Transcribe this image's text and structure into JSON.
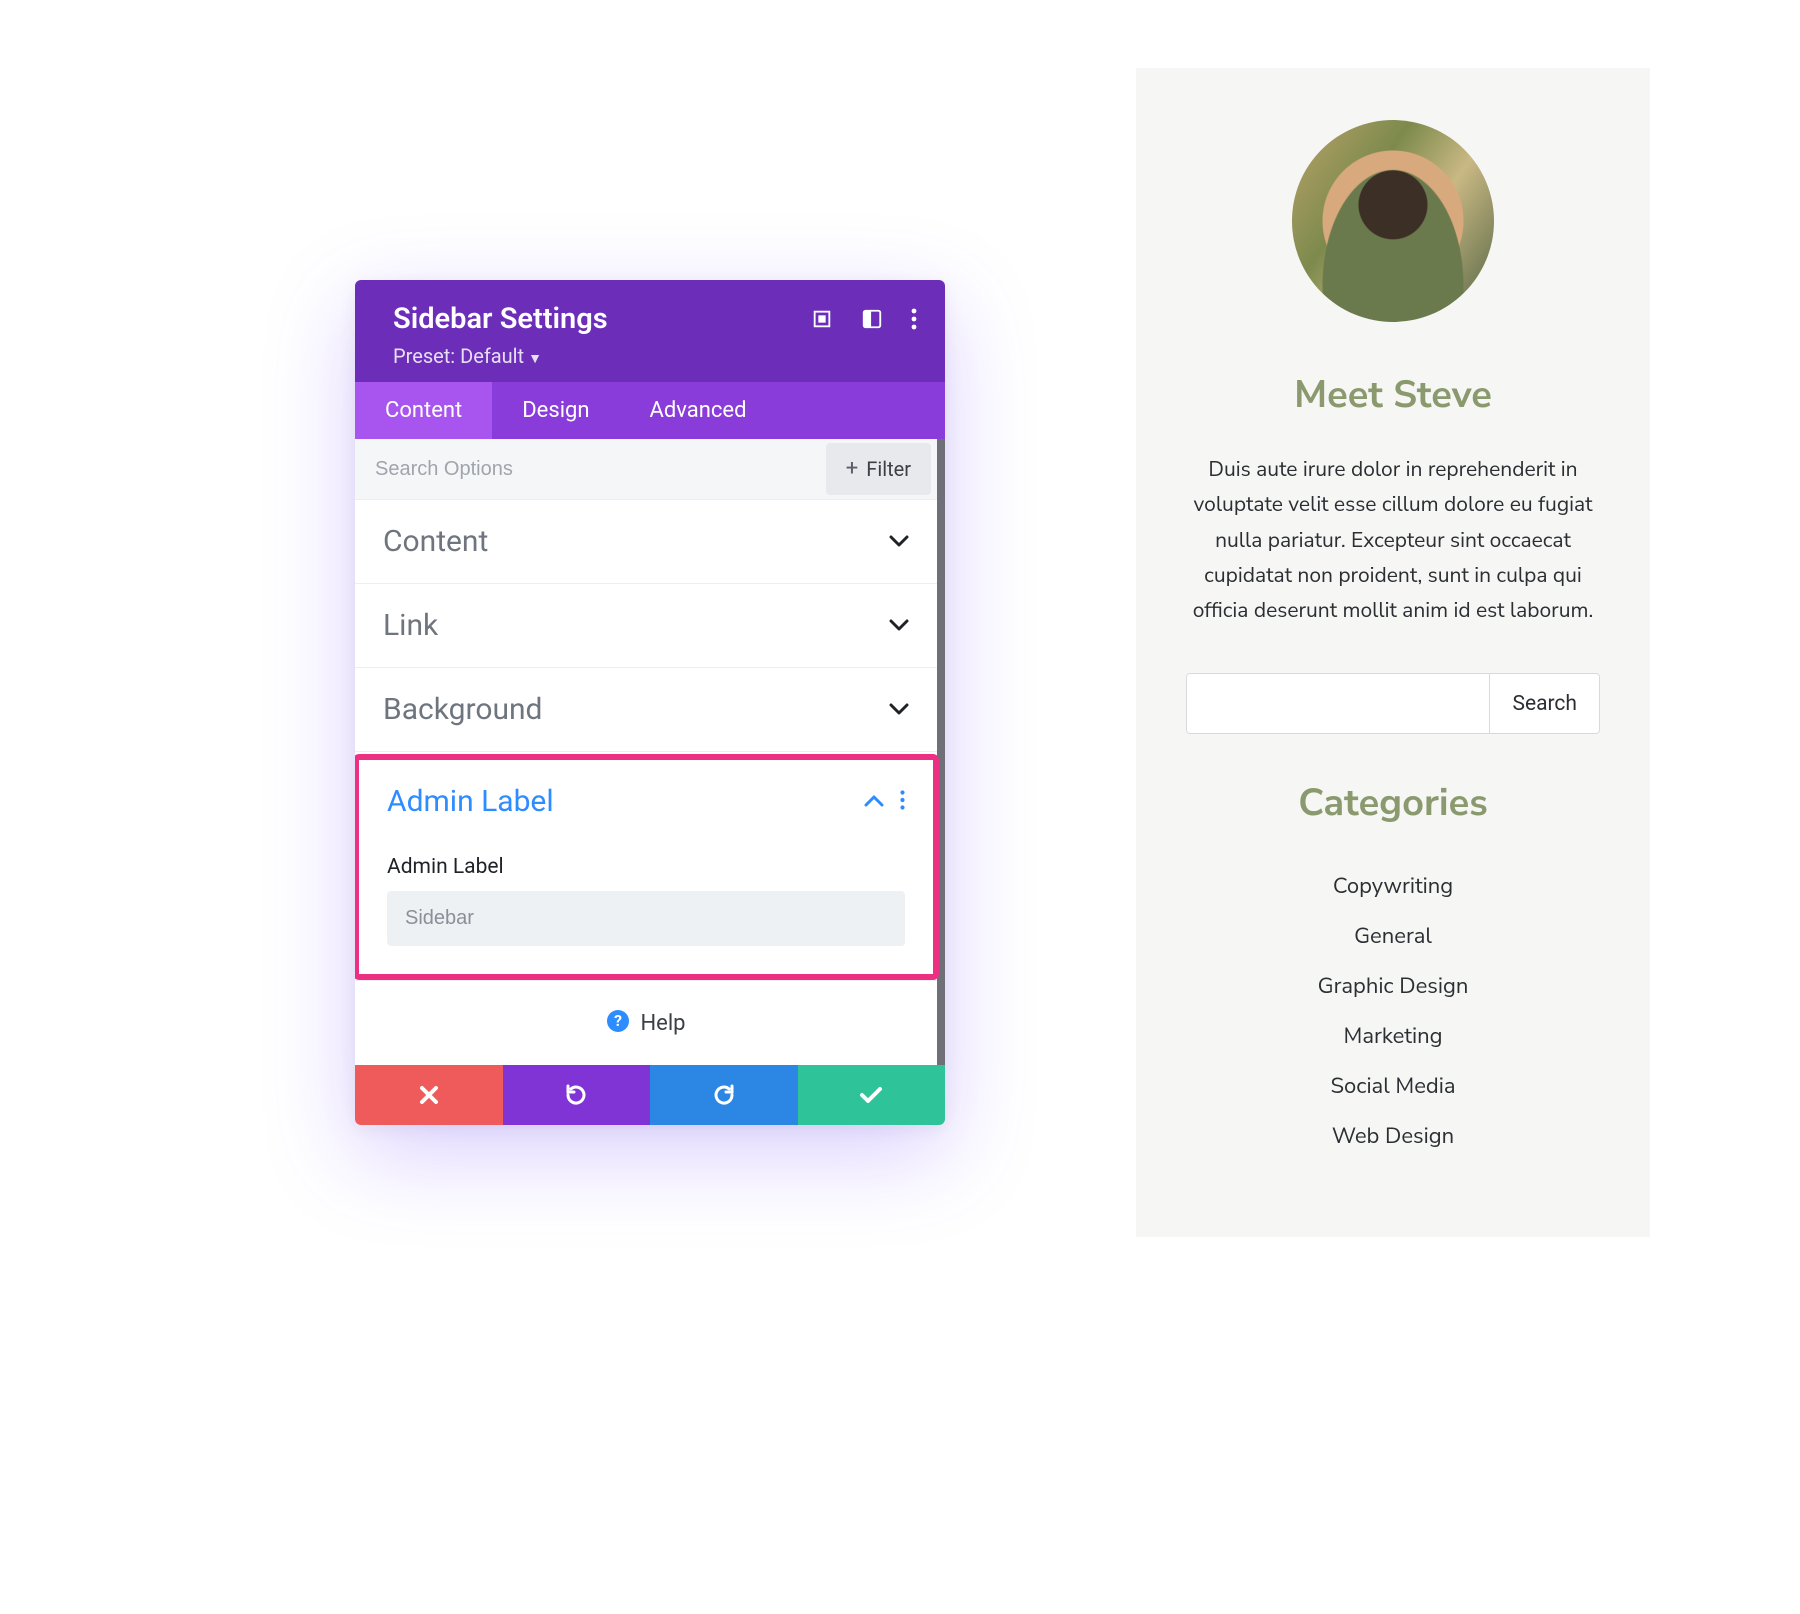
{
  "panel": {
    "title": "Sidebar Settings",
    "preset_label": "Preset: Default",
    "tabs": {
      "content": "Content",
      "design": "Design",
      "advanced": "Advanced"
    },
    "search_placeholder": "Search Options",
    "filter_label": "Filter",
    "sections": {
      "content": "Content",
      "link": "Link",
      "background": "Background",
      "admin_label": "Admin Label"
    },
    "admin_label_field_label": "Admin Label",
    "admin_label_value": "Sidebar",
    "help_label": "Help"
  },
  "preview": {
    "meet_title": "Meet Steve",
    "bio": "Duis aute irure dolor in reprehenderit in voluptate velit esse cillum dolore eu fugiat nulla pariatur. Excepteur sint occaecat cupidatat non proident, sunt in culpa qui officia deserunt mollit anim id est laborum.",
    "search_button": "Search",
    "categories_title": "Categories",
    "categories": [
      "Copywriting",
      "General",
      "Graphic Design",
      "Marketing",
      "Social Media",
      "Web Design"
    ]
  },
  "colors": {
    "header_purple": "#6c2eb9",
    "tab_purple": "#8a3cda",
    "tab_active": "#a855f0",
    "highlight_pink": "#ec2f82",
    "olive_heading": "#8b9a6e",
    "cancel_red": "#ef5a5a",
    "undo_purple": "#8034d6",
    "redo_blue": "#2b87e3",
    "save_teal": "#2fc39a"
  }
}
